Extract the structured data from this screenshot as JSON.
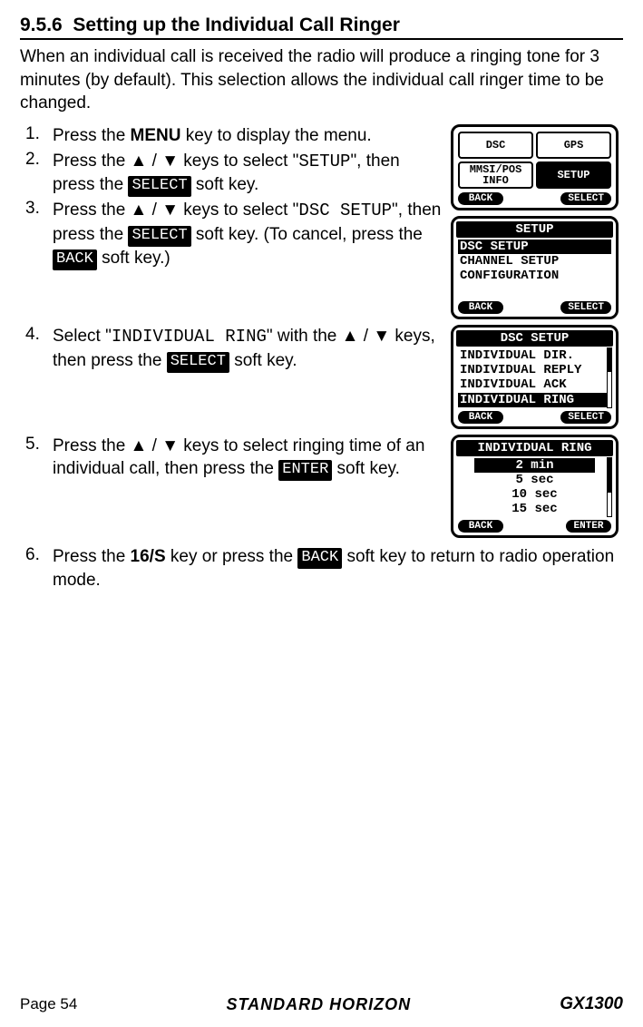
{
  "section": {
    "number": "9.5.6",
    "title": "Setting up the Individual Call Ringer",
    "intro": "When an individual call is received the radio will produce a ringing tone for 3 minutes (by default). This selection allows the individual call ringer time to be changed."
  },
  "keys": {
    "menu": "MENU",
    "up": "▲",
    "down": "▼",
    "sixteen_s": "16/S"
  },
  "soft": {
    "select": "SELECT",
    "back": "BACK",
    "enter": "ENTER"
  },
  "mono": {
    "setup": "SETUP",
    "dsc_setup": "DSC SETUP",
    "individual_ring": "INDIVIDUAL RING"
  },
  "steps": {
    "s1_a": "Press the ",
    "s1_b": " key to display the menu.",
    "s2_a": "Press the ",
    "s2_b": " / ",
    "s2_c": " keys to select \"",
    "s2_d": "\", then press the ",
    "s2_e": " soft key.",
    "s3_a": "Press the ",
    "s3_b": " / ",
    "s3_c": " keys to select \"",
    "s3_d": "\", then press the ",
    "s3_e": " soft key. (To cancel, press the ",
    "s3_f": " soft key.)",
    "s4_a": "Select \"",
    "s4_b": "\" with the ",
    "s4_c": " / ",
    "s4_d": " keys, then press the ",
    "s4_e": " soft key.",
    "s5_a": "Press the ",
    "s5_b": " / ",
    "s5_c": " keys to select ringing time of an individual call, then press the ",
    "s5_d": " soft key.",
    "s6_a": "Press the ",
    "s6_b": " key or press the ",
    "s6_c": " soft key to return to radio operation mode."
  },
  "lcd1": {
    "tiles": {
      "dsc": "DSC",
      "gps": "GPS",
      "mmsi": "MMSI/POS\nINFO",
      "setup": "SETUP"
    },
    "back": "BACK",
    "select": "SELECT"
  },
  "lcd2": {
    "title": "SETUP",
    "items": [
      "DSC SETUP",
      "CHANNEL SETUP",
      "CONFIGURATION"
    ],
    "selected": 0,
    "back": "BACK",
    "select": "SELECT"
  },
  "lcd3": {
    "title": "DSC SETUP",
    "items": [
      "INDIVIDUAL DIR.",
      "INDIVIDUAL REPLY",
      "INDIVIDUAL ACK",
      "INDIVIDUAL RING"
    ],
    "selected": 3,
    "back": "BACK",
    "select": "SELECT"
  },
  "lcd4": {
    "title": "INDIVIDUAL RING",
    "items": [
      " 2 min",
      " 5 sec",
      "10 sec",
      "15 sec"
    ],
    "selected": 0,
    "back": "BACK",
    "enter": "ENTER"
  },
  "footer": {
    "page": "Page 54",
    "brand": "STANDARD HORIZON",
    "model": "GX1300"
  }
}
